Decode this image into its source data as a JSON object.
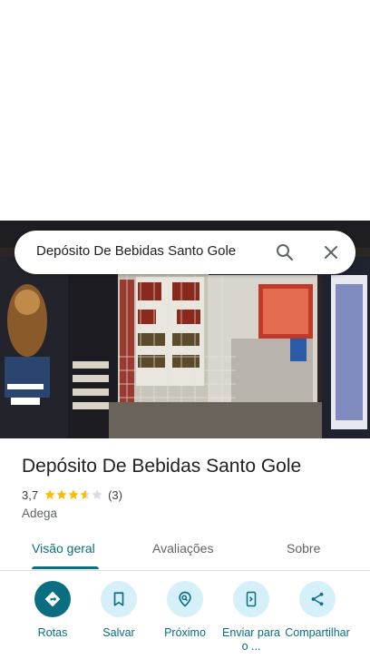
{
  "search": {
    "query": "Depósito De Bebidas Santo Gole"
  },
  "place": {
    "name": "Depósito De Bebidas Santo Gole",
    "rating": "3,7",
    "rating_value": 3.7,
    "review_count": "(3)",
    "category": "Adega"
  },
  "tabs": [
    {
      "label": "Visão geral",
      "active": true
    },
    {
      "label": "Avaliações",
      "active": false
    },
    {
      "label": "Sobre",
      "active": false
    }
  ],
  "actions": [
    {
      "label": "Rotas",
      "icon": "directions-icon"
    },
    {
      "label": "Salvar",
      "icon": "bookmark-icon"
    },
    {
      "label": "Próximo",
      "icon": "nearby-icon"
    },
    {
      "label": "Enviar para o ...",
      "icon": "send-to-phone-icon"
    },
    {
      "label": "Compartilhar",
      "icon": "share-icon"
    }
  ],
  "colors": {
    "accent": "#0b6e80",
    "star": "#fbbc04",
    "chip_bg": "#d6f0fa"
  }
}
